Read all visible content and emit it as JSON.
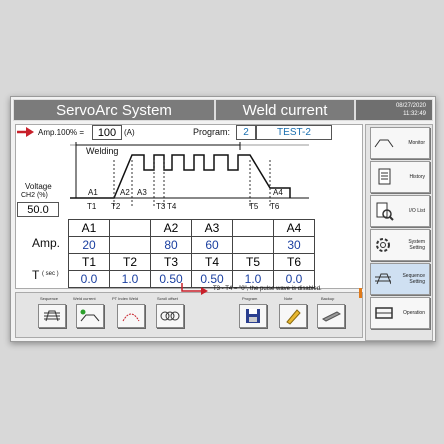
{
  "title": {
    "app": "ServoArc  System",
    "screen": "Weld current",
    "date": "08/27/2020",
    "time": "11:32:49"
  },
  "header": {
    "amp_label": "Amp.100% =",
    "amp_value": "100",
    "amp_unit": "(A)",
    "program_label": "Program:",
    "program_number": "2",
    "program_name": "TEST-2"
  },
  "chart": {
    "welding_label": "Welding",
    "voltage_label": "Voltage",
    "channel_label": "CH2 (%)",
    "voltage_value": "50.0",
    "amp_markers": [
      "A1",
      "A2",
      "A3",
      "A4"
    ],
    "time_markers": [
      "T1",
      "T2",
      "T3",
      "T4",
      "T5",
      "T6"
    ]
  },
  "table": {
    "amp_headers": [
      "A1",
      "",
      "A2",
      "A3",
      "",
      "A4"
    ],
    "amp_label": "Amp.",
    "amp_values": [
      "20",
      "",
      "80",
      "60",
      "",
      "30"
    ],
    "time_headers": [
      "T1",
      "T2",
      "T3",
      "T4",
      "T5",
      "T6"
    ],
    "time_label": "T",
    "time_unit": "( sec )",
    "time_values": [
      "0.0",
      "1.0",
      "0.50",
      "0.50",
      "1.0",
      "0.0"
    ]
  },
  "note": "T3 - T4 = \"0\", the pulse wave is disabled.",
  "bottom_buttons": [
    {
      "label": "Sequence",
      "icon": "sequence-icon"
    },
    {
      "label": "Weld current",
      "icon": "weld-current-icon"
    },
    {
      "label": "PT Index  Weld",
      "icon": "pt-index-icon"
    },
    {
      "label": "Scroll offset",
      "icon": "scroll-offset-icon"
    },
    {
      "label": "Program",
      "icon": "save-icon"
    },
    {
      "label": "Note",
      "icon": "pencil-icon"
    },
    {
      "label": "Backup",
      "icon": "backup-icon"
    }
  ],
  "side_buttons": [
    {
      "label": "Monitor",
      "icon": "monitor-icon"
    },
    {
      "label": "History",
      "icon": "history-icon"
    },
    {
      "label": "I/O List",
      "icon": "io-list-icon"
    },
    {
      "label": "System Setting",
      "icon": "gear-icon"
    },
    {
      "label": "Sequence Setting",
      "icon": "sequence-setting-icon",
      "selected": true
    },
    {
      "label": "Operation",
      "icon": "operation-icon"
    }
  ],
  "colors": {
    "accent_red": "#c8202a",
    "value_blue": "#1a3fa0",
    "selected": "#cfe0f2"
  }
}
